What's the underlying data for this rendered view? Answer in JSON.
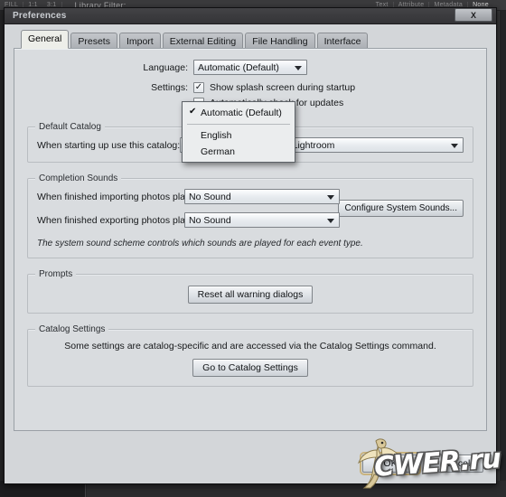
{
  "background_app": {
    "toolbar_segments": [
      "FILL",
      "1:1",
      "3:1"
    ],
    "library_filter_label": "Library Filter:",
    "filter_tabs": [
      "Text",
      "Attribute",
      "Metadata",
      "None"
    ],
    "filter_tab_selected": "None"
  },
  "dialog": {
    "title": "Preferences",
    "close_label": "X",
    "tabs": [
      {
        "label": "General",
        "active": true
      },
      {
        "label": "Presets",
        "active": false
      },
      {
        "label": "Import",
        "active": false
      },
      {
        "label": "External Editing",
        "active": false
      },
      {
        "label": "File Handling",
        "active": false
      },
      {
        "label": "Interface",
        "active": false
      }
    ],
    "language": {
      "label": "Language:",
      "value": "Automatic (Default)",
      "menu_open": true,
      "options": [
        {
          "label": "Automatic (Default)",
          "checked": true,
          "check_glyph": "✔"
        },
        {
          "label": "English",
          "checked": false,
          "check_glyph": ""
        },
        {
          "label": "German",
          "checked": false,
          "check_glyph": ""
        }
      ]
    },
    "settings": {
      "label": "Settings:",
      "items": [
        {
          "label": "Show splash screen during startup",
          "checked": true,
          "check_glyph": "✓"
        },
        {
          "label": "Automatically check for updates",
          "checked": false,
          "check_glyph": ""
        }
      ]
    },
    "default_catalog": {
      "title": "Default Catalog",
      "field_label": "When starting up use this catalog:",
      "value": "Prompt me when starting Lightroom"
    },
    "completion_sounds": {
      "title": "Completion Sounds",
      "import_label": "When finished importing photos play:",
      "import_value": "No Sound",
      "export_label": "When finished exporting photos play:",
      "export_value": "No Sound",
      "configure_button": "Configure System Sounds...",
      "hint": "The system sound scheme controls which sounds are played for each event type."
    },
    "prompts": {
      "title": "Prompts",
      "reset_button": "Reset all warning dialogs"
    },
    "catalog_settings": {
      "title": "Catalog Settings",
      "description": "Some settings are catalog-specific and are accessed via the Catalog Settings command.",
      "button": "Go to Catalog Settings"
    },
    "footer": {
      "ok_label": "OK",
      "cancel_label": "Cancel"
    }
  },
  "watermark": {
    "text": "CWER.ru"
  },
  "colors": {
    "dialog_bg": "#d3d6d9",
    "panel_bg": "#d9dcdf",
    "titlebar": "#3a3a3c",
    "active_tab": "#edeee9",
    "focus_ring": "#c9b37e",
    "app_bg": "#2e2e30"
  }
}
